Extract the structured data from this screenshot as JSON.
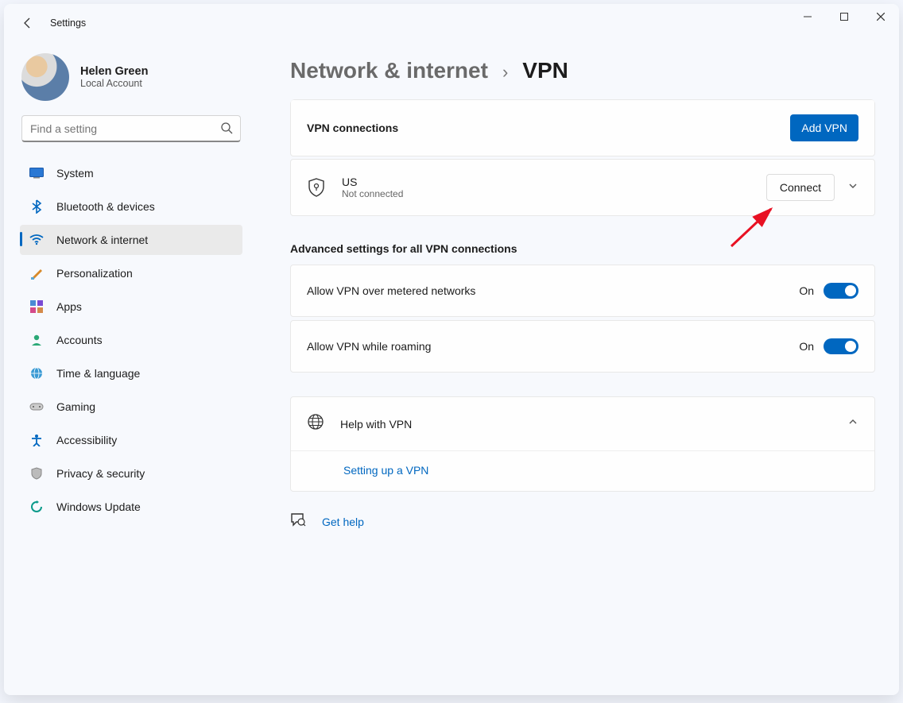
{
  "app_title": "Settings",
  "profile": {
    "name": "Helen Green",
    "subtitle": "Local Account"
  },
  "search": {
    "placeholder": "Find a setting"
  },
  "sidebar": {
    "items": [
      {
        "label": "System"
      },
      {
        "label": "Bluetooth & devices"
      },
      {
        "label": "Network & internet"
      },
      {
        "label": "Personalization"
      },
      {
        "label": "Apps"
      },
      {
        "label": "Accounts"
      },
      {
        "label": "Time & language"
      },
      {
        "label": "Gaming"
      },
      {
        "label": "Accessibility"
      },
      {
        "label": "Privacy & security"
      },
      {
        "label": "Windows Update"
      }
    ]
  },
  "breadcrumb": {
    "parent": "Network & internet",
    "current": "VPN"
  },
  "vpn": {
    "section_label": "VPN connections",
    "add_button": "Add VPN",
    "item": {
      "name": "US",
      "status": "Not connected",
      "connect_label": "Connect"
    }
  },
  "advanced": {
    "title": "Advanced settings for all VPN connections",
    "rows": [
      {
        "label": "Allow VPN over metered networks",
        "state": "On"
      },
      {
        "label": "Allow VPN while roaming",
        "state": "On"
      }
    ]
  },
  "help": {
    "title": "Help with VPN",
    "link": "Setting up a VPN"
  },
  "get_help": "Get help",
  "colors": {
    "accent": "#0067c0"
  }
}
